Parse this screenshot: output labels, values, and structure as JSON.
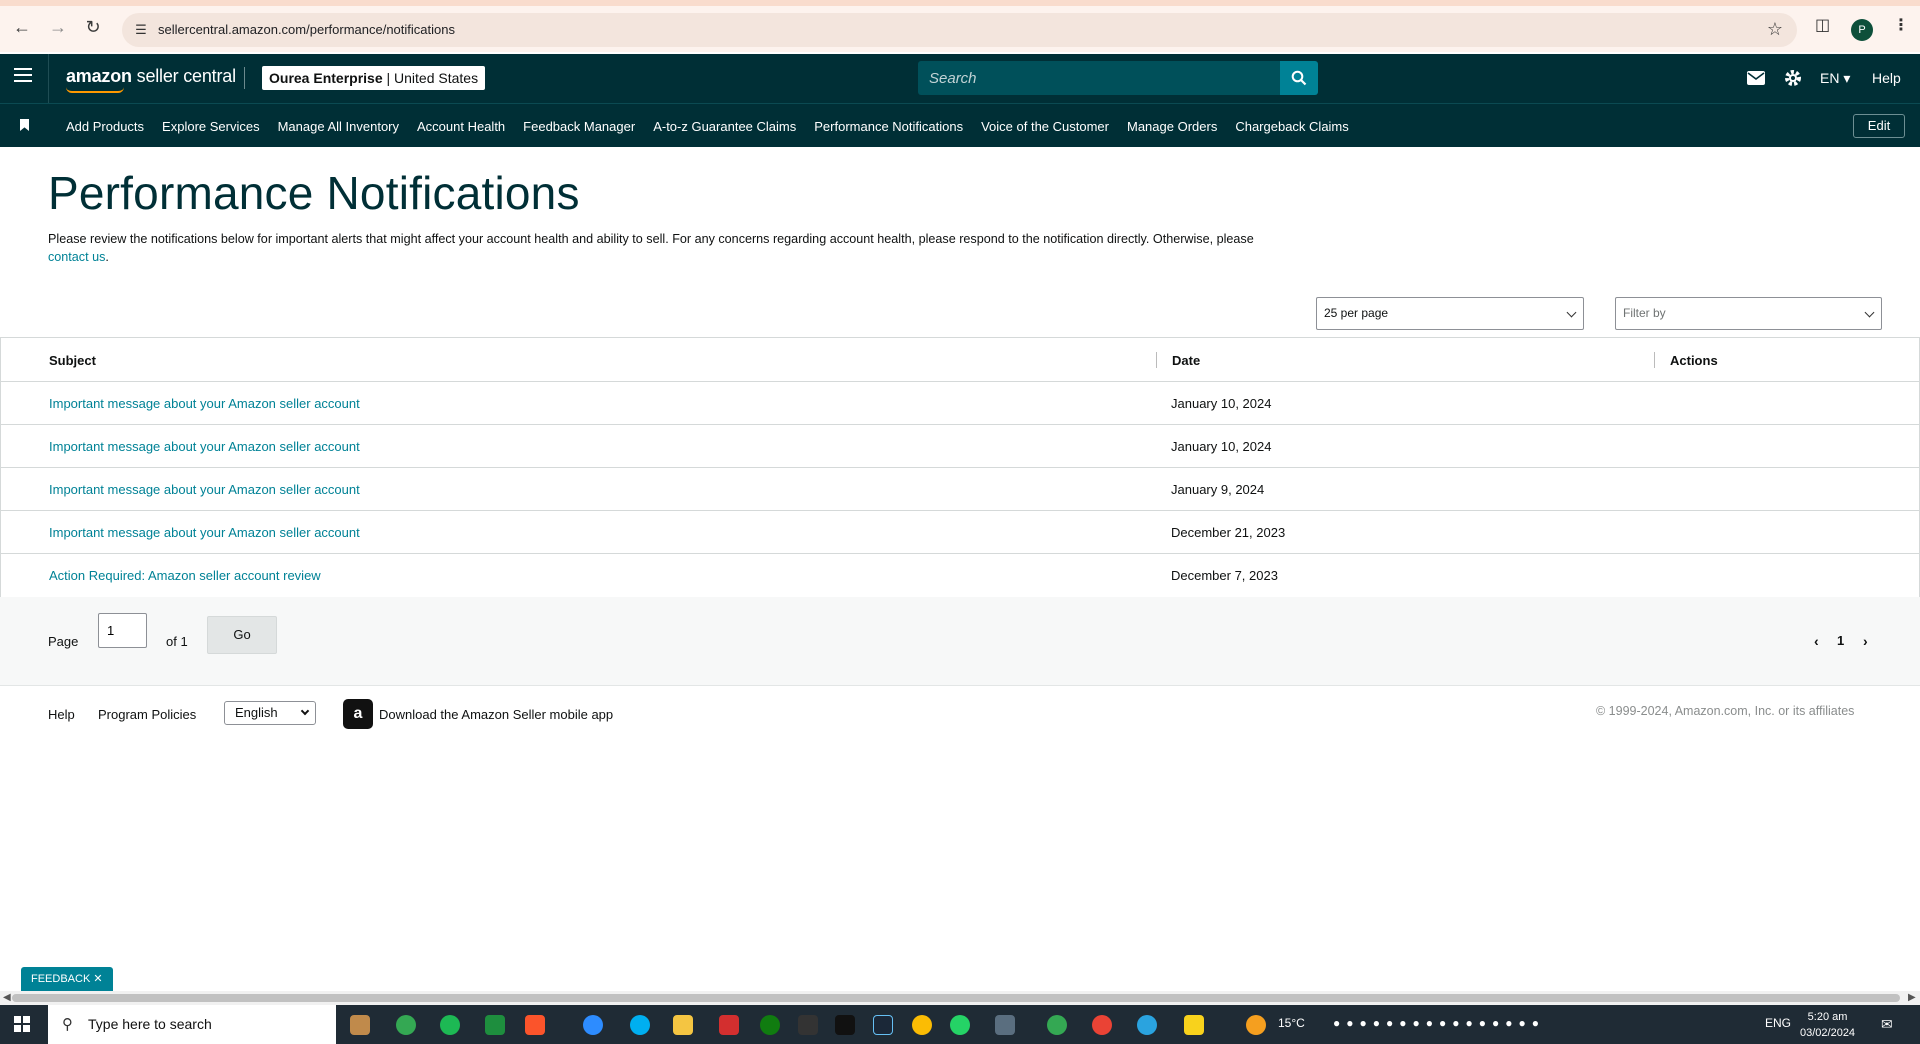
{
  "browser": {
    "url": "sellercentral.amazon.com/performance/notifications"
  },
  "header": {
    "logo_word": "amazon",
    "logo_rest": "seller central",
    "merchant_name": "Ourea Enterprise",
    "merchant_region": " | United States",
    "search_placeholder": "Search",
    "language": "EN",
    "help": "Help"
  },
  "nav": {
    "items": [
      "Add Products",
      "Explore Services",
      "Manage All Inventory",
      "Account Health",
      "Feedback Manager",
      "A-to-z Guarantee Claims",
      "Performance Notifications",
      "Voice of the Customer",
      "Manage Orders",
      "Chargeback Claims"
    ],
    "edit": "Edit"
  },
  "page": {
    "title": "Performance Notifications",
    "intro_text": "Please review the notifications below for important alerts that might affect your account health and ability to sell. For any concerns regarding account health, please respond to the notification directly. Otherwise, please ",
    "intro_link": "contact us",
    "intro_end": "."
  },
  "controls": {
    "per_page": "25 per page",
    "filter_placeholder": "Filter by"
  },
  "table": {
    "headers": {
      "subject": "Subject",
      "date": "Date",
      "actions": "Actions"
    },
    "rows": [
      {
        "subject": "Important message about your Amazon seller account",
        "date": "January 10, 2024"
      },
      {
        "subject": "Important message about your Amazon seller account",
        "date": "January 10, 2024"
      },
      {
        "subject": "Important message about your Amazon seller account",
        "date": "January 9, 2024"
      },
      {
        "subject": "Important message about your Amazon seller account",
        "date": "December 21, 2023"
      },
      {
        "subject": "Action Required: Amazon seller account review",
        "date": "December 7, 2023"
      }
    ]
  },
  "pagination": {
    "page_label": "Page",
    "page_value": "1",
    "of_label": "of 1",
    "go": "Go",
    "current": "1"
  },
  "footer": {
    "help": "Help",
    "program_policies": "Program Policies",
    "language": "English",
    "app_link": "Download the Amazon Seller mobile app",
    "copyright": "© 1999-2024, Amazon.com, Inc. or its affiliates"
  },
  "feedback": "FEEDBACK ✕",
  "taskbar": {
    "search_text": "Type here to search",
    "weather": "15°C",
    "lang": "ENG",
    "time": "5:20 am",
    "date": "03/02/2024"
  }
}
